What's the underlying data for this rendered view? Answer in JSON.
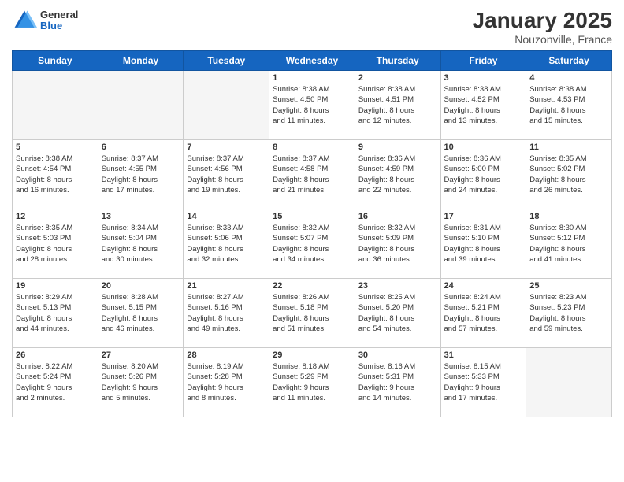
{
  "logo": {
    "general": "General",
    "blue": "Blue"
  },
  "header": {
    "title": "January 2025",
    "location": "Nouzonville, France"
  },
  "weekdays": [
    "Sunday",
    "Monday",
    "Tuesday",
    "Wednesday",
    "Thursday",
    "Friday",
    "Saturday"
  ],
  "weeks": [
    [
      {
        "day": "",
        "info": ""
      },
      {
        "day": "",
        "info": ""
      },
      {
        "day": "",
        "info": ""
      },
      {
        "day": "1",
        "info": "Sunrise: 8:38 AM\nSunset: 4:50 PM\nDaylight: 8 hours\nand 11 minutes."
      },
      {
        "day": "2",
        "info": "Sunrise: 8:38 AM\nSunset: 4:51 PM\nDaylight: 8 hours\nand 12 minutes."
      },
      {
        "day": "3",
        "info": "Sunrise: 8:38 AM\nSunset: 4:52 PM\nDaylight: 8 hours\nand 13 minutes."
      },
      {
        "day": "4",
        "info": "Sunrise: 8:38 AM\nSunset: 4:53 PM\nDaylight: 8 hours\nand 15 minutes."
      }
    ],
    [
      {
        "day": "5",
        "info": "Sunrise: 8:38 AM\nSunset: 4:54 PM\nDaylight: 8 hours\nand 16 minutes."
      },
      {
        "day": "6",
        "info": "Sunrise: 8:37 AM\nSunset: 4:55 PM\nDaylight: 8 hours\nand 17 minutes."
      },
      {
        "day": "7",
        "info": "Sunrise: 8:37 AM\nSunset: 4:56 PM\nDaylight: 8 hours\nand 19 minutes."
      },
      {
        "day": "8",
        "info": "Sunrise: 8:37 AM\nSunset: 4:58 PM\nDaylight: 8 hours\nand 21 minutes."
      },
      {
        "day": "9",
        "info": "Sunrise: 8:36 AM\nSunset: 4:59 PM\nDaylight: 8 hours\nand 22 minutes."
      },
      {
        "day": "10",
        "info": "Sunrise: 8:36 AM\nSunset: 5:00 PM\nDaylight: 8 hours\nand 24 minutes."
      },
      {
        "day": "11",
        "info": "Sunrise: 8:35 AM\nSunset: 5:02 PM\nDaylight: 8 hours\nand 26 minutes."
      }
    ],
    [
      {
        "day": "12",
        "info": "Sunrise: 8:35 AM\nSunset: 5:03 PM\nDaylight: 8 hours\nand 28 minutes."
      },
      {
        "day": "13",
        "info": "Sunrise: 8:34 AM\nSunset: 5:04 PM\nDaylight: 8 hours\nand 30 minutes."
      },
      {
        "day": "14",
        "info": "Sunrise: 8:33 AM\nSunset: 5:06 PM\nDaylight: 8 hours\nand 32 minutes."
      },
      {
        "day": "15",
        "info": "Sunrise: 8:32 AM\nSunset: 5:07 PM\nDaylight: 8 hours\nand 34 minutes."
      },
      {
        "day": "16",
        "info": "Sunrise: 8:32 AM\nSunset: 5:09 PM\nDaylight: 8 hours\nand 36 minutes."
      },
      {
        "day": "17",
        "info": "Sunrise: 8:31 AM\nSunset: 5:10 PM\nDaylight: 8 hours\nand 39 minutes."
      },
      {
        "day": "18",
        "info": "Sunrise: 8:30 AM\nSunset: 5:12 PM\nDaylight: 8 hours\nand 41 minutes."
      }
    ],
    [
      {
        "day": "19",
        "info": "Sunrise: 8:29 AM\nSunset: 5:13 PM\nDaylight: 8 hours\nand 44 minutes."
      },
      {
        "day": "20",
        "info": "Sunrise: 8:28 AM\nSunset: 5:15 PM\nDaylight: 8 hours\nand 46 minutes."
      },
      {
        "day": "21",
        "info": "Sunrise: 8:27 AM\nSunset: 5:16 PM\nDaylight: 8 hours\nand 49 minutes."
      },
      {
        "day": "22",
        "info": "Sunrise: 8:26 AM\nSunset: 5:18 PM\nDaylight: 8 hours\nand 51 minutes."
      },
      {
        "day": "23",
        "info": "Sunrise: 8:25 AM\nSunset: 5:20 PM\nDaylight: 8 hours\nand 54 minutes."
      },
      {
        "day": "24",
        "info": "Sunrise: 8:24 AM\nSunset: 5:21 PM\nDaylight: 8 hours\nand 57 minutes."
      },
      {
        "day": "25",
        "info": "Sunrise: 8:23 AM\nSunset: 5:23 PM\nDaylight: 8 hours\nand 59 minutes."
      }
    ],
    [
      {
        "day": "26",
        "info": "Sunrise: 8:22 AM\nSunset: 5:24 PM\nDaylight: 9 hours\nand 2 minutes."
      },
      {
        "day": "27",
        "info": "Sunrise: 8:20 AM\nSunset: 5:26 PM\nDaylight: 9 hours\nand 5 minutes."
      },
      {
        "day": "28",
        "info": "Sunrise: 8:19 AM\nSunset: 5:28 PM\nDaylight: 9 hours\nand 8 minutes."
      },
      {
        "day": "29",
        "info": "Sunrise: 8:18 AM\nSunset: 5:29 PM\nDaylight: 9 hours\nand 11 minutes."
      },
      {
        "day": "30",
        "info": "Sunrise: 8:16 AM\nSunset: 5:31 PM\nDaylight: 9 hours\nand 14 minutes."
      },
      {
        "day": "31",
        "info": "Sunrise: 8:15 AM\nSunset: 5:33 PM\nDaylight: 9 hours\nand 17 minutes."
      },
      {
        "day": "",
        "info": ""
      }
    ]
  ]
}
